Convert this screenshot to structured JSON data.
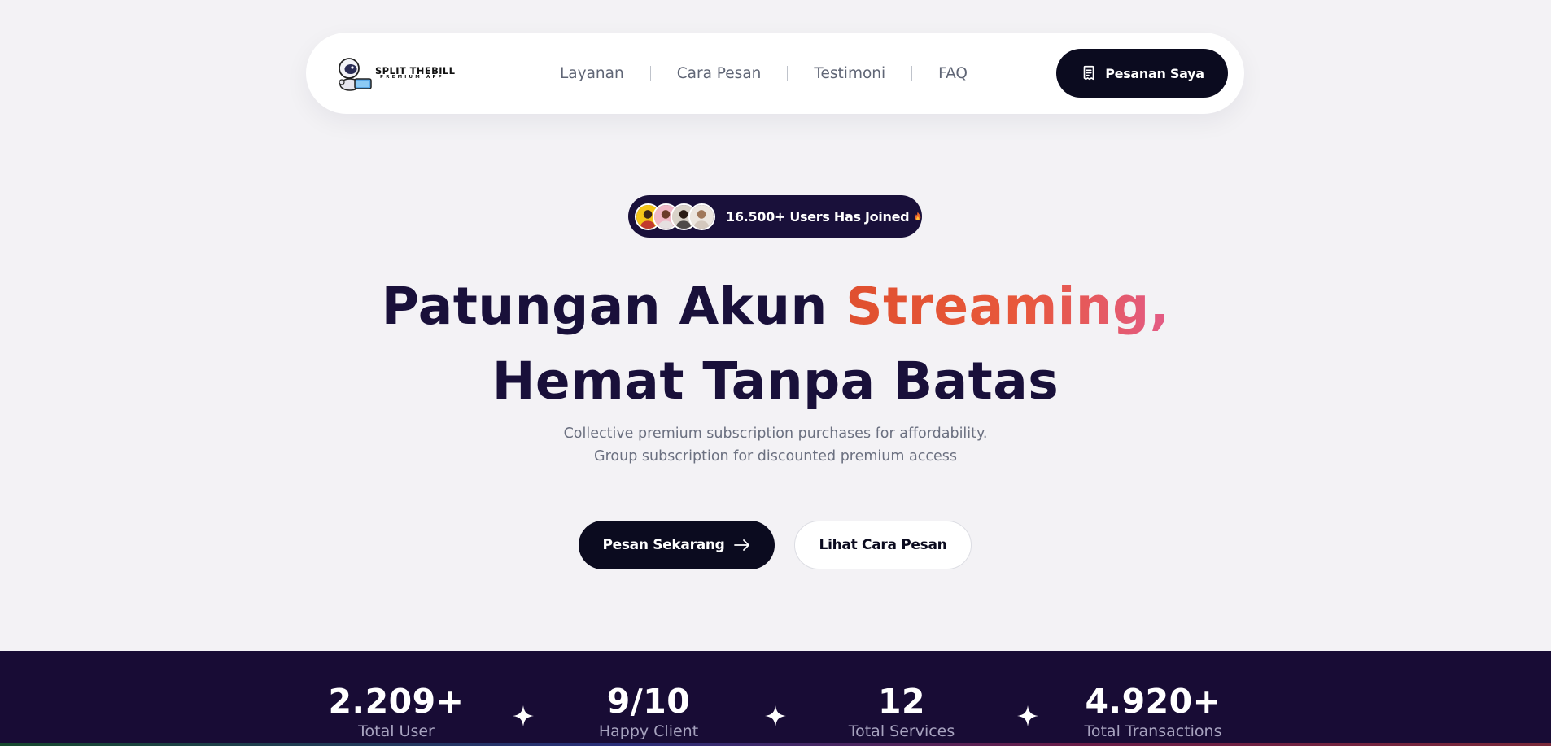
{
  "nav": {
    "logo": {
      "title": "SPLIT THEBILL",
      "subtitle": "PREMIUM APP"
    },
    "links": [
      "Layanan",
      "Cara Pesan",
      "Testimoni",
      "FAQ"
    ],
    "orders_button": "Pesanan Saya"
  },
  "badge": {
    "text": "16.500+ Users Has Joined"
  },
  "hero": {
    "title_line1_plain": "Patungan Akun ",
    "title_line1_accent": "Streaming,",
    "title_line2": "Hemat Tanpa Batas",
    "subtitle_line1": "Collective premium subscription purchases for affordability.",
    "subtitle_line2": "Group subscription for discounted premium access"
  },
  "cta": {
    "primary": "Pesan Sekarang",
    "secondary": "Lihat Cara Pesan"
  },
  "stats": [
    {
      "value": "2.209+",
      "label": "Total User"
    },
    {
      "value": "9/10",
      "label": "Happy Client"
    },
    {
      "value": "12",
      "label": "Total Services"
    },
    {
      "value": "4.920+",
      "label": "Total Transactions"
    }
  ],
  "colors": {
    "background": "#f3f2f5",
    "dark": "#0b0b1f",
    "heading": "#19103a",
    "accent_start": "#e0502f",
    "accent_end": "#e35b86",
    "stats_band": "#180c35"
  }
}
